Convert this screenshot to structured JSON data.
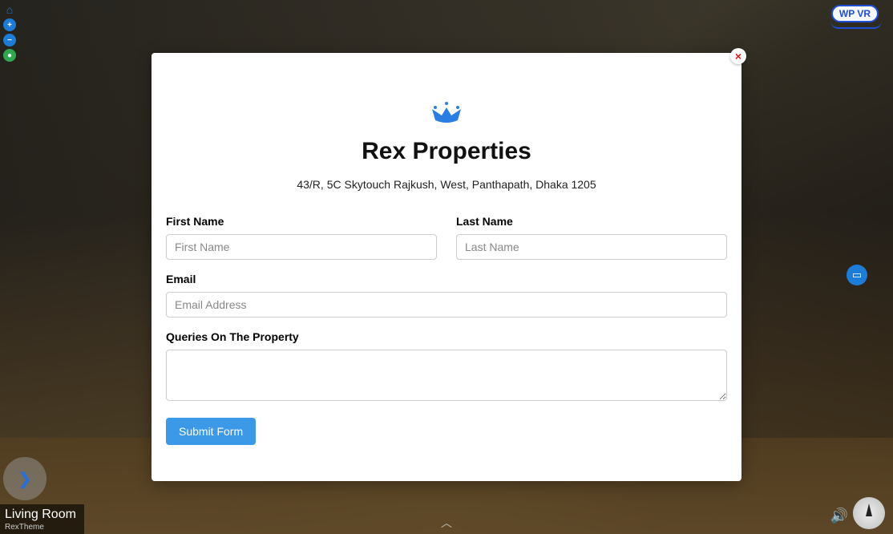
{
  "controls": {
    "home_glyph": "⌂",
    "plus_glyph": "+",
    "minus_glyph": "−",
    "fullscreen_glyph": "●"
  },
  "wpvr": {
    "label": "WP VR"
  },
  "hotspot": {
    "glyph": "▭"
  },
  "nav": {
    "chevron": "❯"
  },
  "scene": {
    "title": "Living Room",
    "subtitle": "RexTheme"
  },
  "audio": {
    "glyph": "🔊"
  },
  "bottom_chevron": "︿",
  "modal": {
    "close_glyph": "×",
    "title": "Rex Properties",
    "subtitle": "43/R, 5C Skytouch Rajkush, West, Panthapath, Dhaka 1205",
    "fields": {
      "first_name": {
        "label": "First Name",
        "placeholder": "First Name",
        "value": ""
      },
      "last_name": {
        "label": "Last Name",
        "placeholder": "Last Name",
        "value": ""
      },
      "email": {
        "label": "Email",
        "placeholder": "Email Address",
        "value": ""
      },
      "queries": {
        "label": "Queries On The Property",
        "placeholder": "",
        "value": ""
      }
    },
    "submit_label": "Submit Form"
  },
  "colors": {
    "accent": "#1c7cd6",
    "submit": "#3b99e8",
    "close": "#e11"
  }
}
